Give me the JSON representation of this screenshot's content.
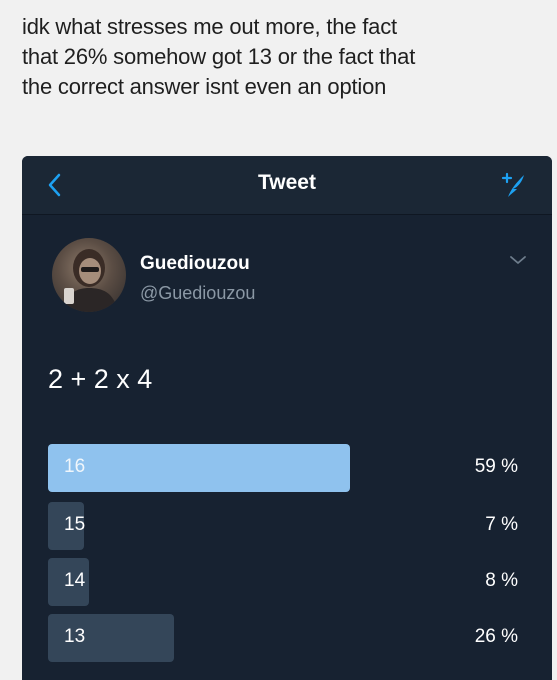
{
  "caption": {
    "line1": "idk what stresses me out more, the fact",
    "line2": "that 26% somehow got 13 or the fact that",
    "line3": "the correct answer isnt even an option"
  },
  "nav": {
    "title": "Tweet",
    "back_icon": "chevron-left-icon",
    "compose_icon": "compose-tweet-icon"
  },
  "tweet": {
    "display_name": "Guediouzou",
    "handle": "@Guediouzou",
    "text": "2 + 2 x 4"
  },
  "poll": {
    "options": [
      {
        "label": "16",
        "percent_text": "59 %",
        "percent": 59,
        "winner": true
      },
      {
        "label": "15",
        "percent_text": "7 %",
        "percent": 7,
        "winner": false
      },
      {
        "label": "14",
        "percent_text": "8 %",
        "percent": 8,
        "winner": false
      },
      {
        "label": "13",
        "percent_text": "26 %",
        "percent": 26,
        "winner": false
      }
    ]
  },
  "colors": {
    "accent": "#1da1f2",
    "winner_bar": "#8fc2ee",
    "bar": "#344659",
    "background": "#172231"
  }
}
